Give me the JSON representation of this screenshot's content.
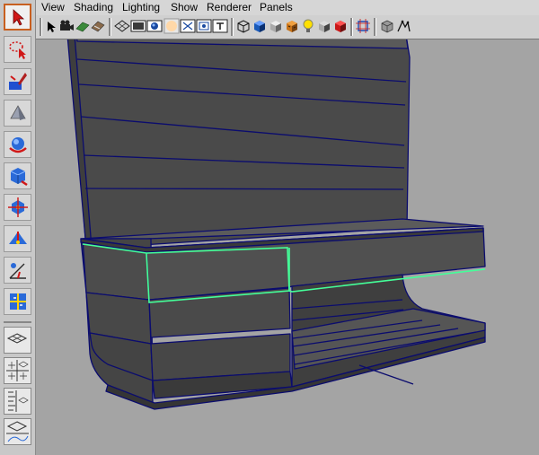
{
  "menu": [
    "View",
    "Shading",
    "Lighting",
    "Show",
    "Renderer",
    "Panels"
  ],
  "colors": {
    "viewport": "#a4a4a4",
    "mesh": "#4d4d4d",
    "wire": "#0b0c6e",
    "selection": "#44ff99",
    "active_tool": "#c86020"
  },
  "toolbox": {
    "tools": [
      "select-tool-icon",
      "lasso-tool-icon",
      "paint-select-tool-icon",
      "move-tool-icon",
      "rotate-tool-icon",
      "scale-tool-icon",
      "universal-manipulator-icon",
      "soft-modification-icon",
      "show-manipulator-icon",
      "last-tool-icon"
    ],
    "layouts": [
      "single-perspective-layout-icon",
      "four-view-layout-icon",
      "outliner-layout-icon",
      "persp-graph-layout-icon"
    ]
  },
  "iconbar": [
    "select-camera-icon",
    "camera-attributes-icon",
    "bookmark-icon",
    "image-plane-icon",
    "grid-toggle-icon",
    "film-gate-icon",
    "resolution-gate-icon",
    "gate-mask-icon",
    "field-chart-icon",
    "safe-action-icon",
    "safe-title-icon",
    "wireframe-icon",
    "smooth-shade-icon",
    "default-material-icon",
    "textured-icon",
    "use-all-lights-icon",
    "shadows-icon",
    "xray-icon",
    "isolate-select-icon",
    "frame-all-icon",
    "hud-icon",
    "symmetry-icon"
  ]
}
